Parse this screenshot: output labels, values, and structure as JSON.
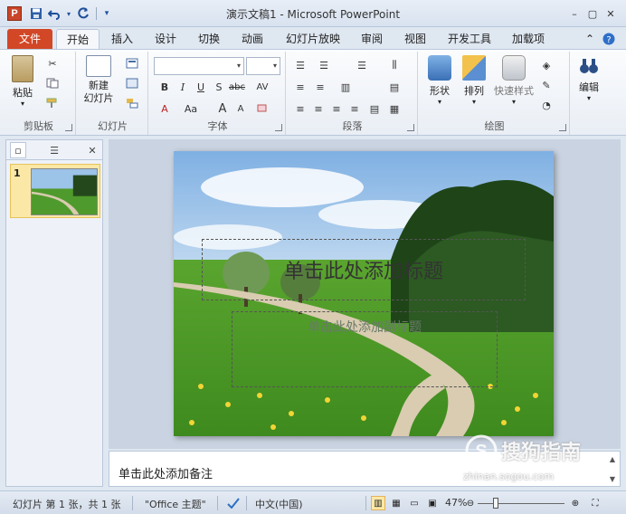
{
  "window": {
    "title": "演示文稿1 - Microsoft PowerPoint",
    "app_icon_letter": "P",
    "minimize_glyph": "–",
    "maximize_glyph": "▢",
    "close_glyph": "✕"
  },
  "ribbon_tabs": [
    {
      "label": "文件"
    },
    {
      "label": "开始"
    },
    {
      "label": "插入"
    },
    {
      "label": "设计"
    },
    {
      "label": "切换"
    },
    {
      "label": "动画"
    },
    {
      "label": "幻灯片放映"
    },
    {
      "label": "审阅"
    },
    {
      "label": "视图"
    },
    {
      "label": "开发工具"
    },
    {
      "label": "加载项"
    }
  ],
  "ribbon": {
    "clipboard": {
      "paste_label": "粘贴",
      "group_label": "剪贴板"
    },
    "slides": {
      "new_slide_label": "新建\n幻灯片",
      "group_label": "幻灯片"
    },
    "font": {
      "bold": "B",
      "italic": "I",
      "underline": "U",
      "strike": "S",
      "abc": "abc",
      "av": "AV",
      "font_color": "A",
      "aa": "Aa",
      "grow": "A",
      "shrink": "A",
      "group_label": "字体"
    },
    "paragraph": {
      "group_label": "段落"
    },
    "drawing": {
      "shape_label": "形状",
      "arrange_label": "排列",
      "quick_styles_label": "快速样式",
      "group_label": "绘图"
    },
    "editing": {
      "label": "编辑"
    }
  },
  "slide_panel": {
    "slide_number": "1"
  },
  "slide": {
    "title_placeholder": "单击此处添加标题",
    "subtitle_placeholder": "单击此处添加副标题"
  },
  "notes": {
    "placeholder": "单击此处添加备注"
  },
  "watermark": {
    "text": "搜狗指南",
    "url": "zhinan.sogou.com"
  },
  "status_bar": {
    "slide_info": "幻灯片 第 1 张，共 1 张",
    "theme": "\"Office 主题\"",
    "language": "中文(中国)",
    "zoom": "47%",
    "zoom_level": 0.47
  },
  "colors": {
    "file_tab": "#d24726",
    "accent_blue": "#1e4f9a",
    "selected_thumb": "#fbe8a6"
  }
}
